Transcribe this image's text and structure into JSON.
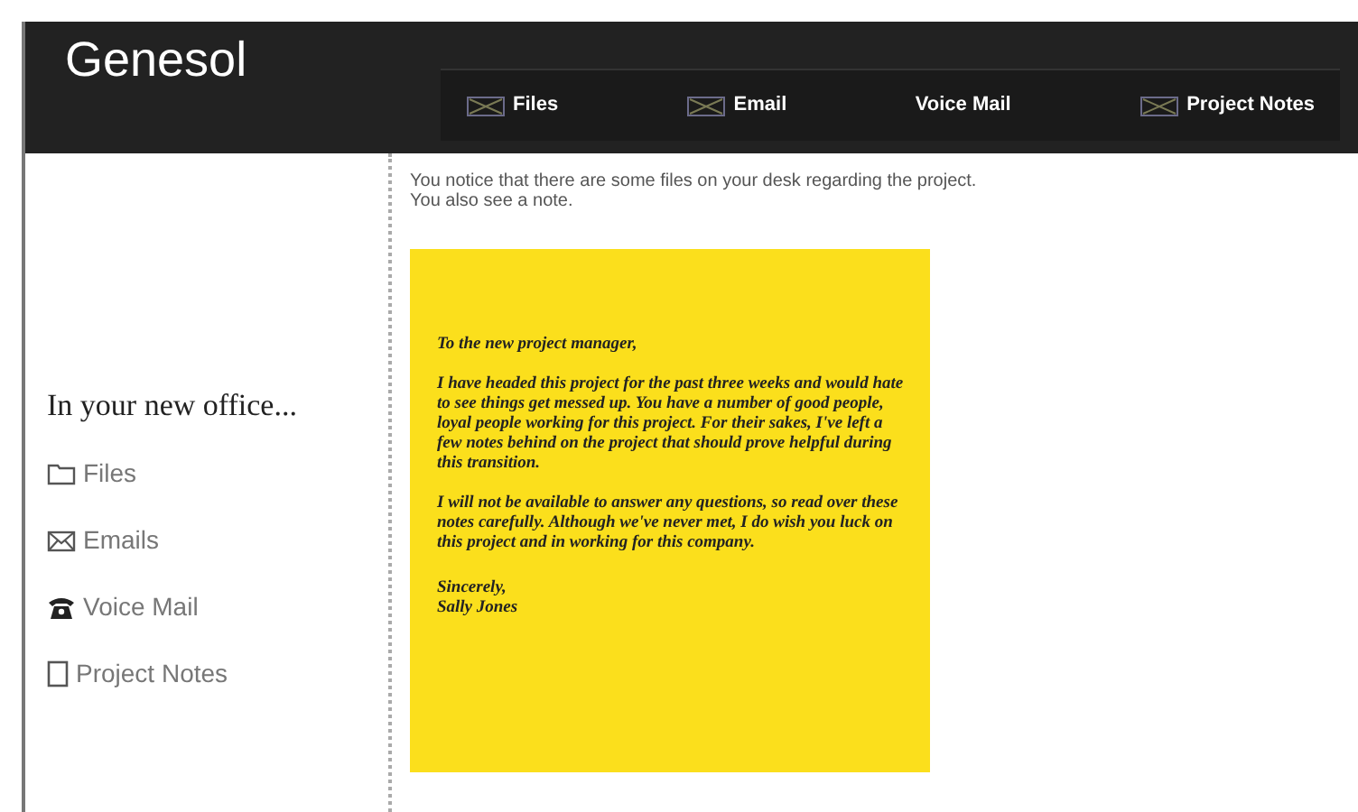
{
  "header": {
    "logo": "Genesol"
  },
  "nav": [
    {
      "label": "Files",
      "has_icon": true
    },
    {
      "label": "Email",
      "has_icon": true
    },
    {
      "label": "Voice Mail",
      "has_icon": false
    },
    {
      "label": "Project Notes",
      "has_icon": true
    }
  ],
  "sidebar": {
    "heading": "In your new office...",
    "items": [
      {
        "kind": "folder",
        "label": "Files"
      },
      {
        "kind": "envelope",
        "label": "Emails"
      },
      {
        "kind": "phone",
        "label": "Voice Mail"
      },
      {
        "kind": "page",
        "label": "Project Notes"
      }
    ]
  },
  "intro": [
    "You notice that there are some files on your desk regarding the project.",
    "You also see a note."
  ],
  "note": {
    "paragraphs": [
      "To the new project manager,",
      "I have headed this project for the past three weeks and would hate to see things get messed up. You have a number of good people, loyal people working for this project. For their sakes, I've left a few notes behind on the project that should prove helpful during this transition.",
      "I will not be available to answer any questions, so read over these notes carefully. Although we've never met, I do wish you luck on this project and in working for this company."
    ],
    "closing": [
      "Sincerely,",
      "Sally Jones"
    ]
  }
}
